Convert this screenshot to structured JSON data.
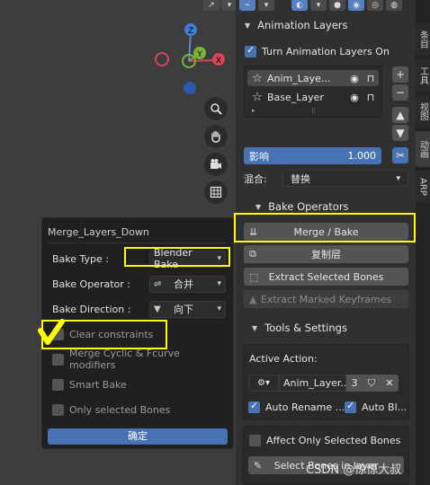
{
  "viewport": {
    "top_icons": [
      "↗",
      "▾",
      "⌁",
      "▾",
      "◐",
      "▾",
      "●",
      "◉",
      "◎",
      "◍"
    ],
    "gizmo": {
      "z": "Z",
      "y": "Y",
      "x": "X"
    }
  },
  "popup": {
    "title": "Merge_Layers_Down",
    "bake_type_label": "Bake Type :",
    "bake_type_value": "Blender Bake",
    "bake_operator_label": "Bake Operator :",
    "bake_operator_value": "合并",
    "bake_direction_label": "Bake Direction :",
    "bake_direction_value": "向下",
    "clear_constraints": "Clear constraints",
    "merge_cyclic": "Merge Cyclic & Fcurve modifiers",
    "smart_bake": "Smart Bake",
    "only_selected_bones": "Only selected Bones",
    "ok": "确定"
  },
  "panel": {
    "animation_layers_header": "Animation Layers",
    "turn_on": "Turn Animation Layers On",
    "layers": [
      {
        "name": "Anim_Laye..."
      },
      {
        "name": "Base_Layer"
      }
    ],
    "influence_label": "影响",
    "influence_value": "1.000",
    "blend_label": "混合:",
    "blend_value": "替换",
    "bake_operators_header": "Bake Operators",
    "merge_bake": "Merge / Bake",
    "duplicate_layer": "复制层",
    "extract_selected_bones": "Extract Selected Bones",
    "extract_marked_keyframes": "Extract Marked Keyframes",
    "tools_settings_header": "Tools & Settings",
    "active_action_label": "Active Action:",
    "active_action_value": "Anim_Layer...",
    "active_action_users": "3",
    "auto_rename": "Auto Rename ...",
    "auto_blend": "Auto Bl...",
    "affect_only_selected": "Affect Only Selected Bones",
    "select_bones": "Select Bones in layer"
  },
  "tabs": [
    "条目",
    "工具",
    "视图",
    "动画",
    "ARP"
  ],
  "watermark": "CSDN @惊惊大叔"
}
